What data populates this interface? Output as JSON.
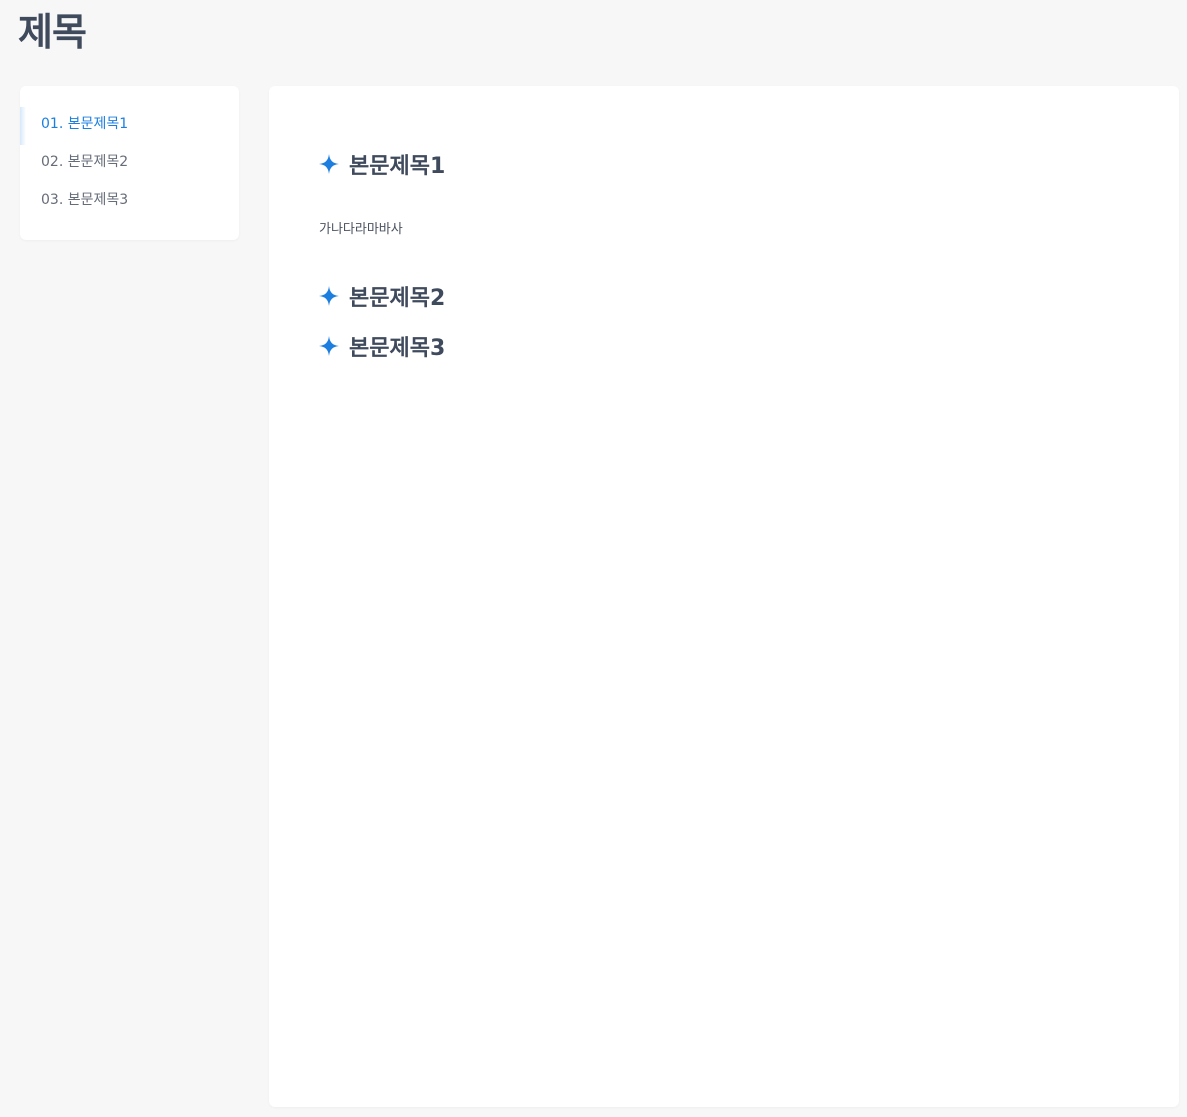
{
  "page": {
    "title": "제목"
  },
  "toc": {
    "items": [
      {
        "label": "01. 본문제목1",
        "active": true
      },
      {
        "label": "02. 본문제목2",
        "active": false
      },
      {
        "label": "03. 본문제목3",
        "active": false
      }
    ]
  },
  "content": {
    "sections": [
      {
        "heading": "본문제목1",
        "body": "가나다라마바사"
      },
      {
        "heading": "본문제목2"
      },
      {
        "heading": "본문제목3"
      }
    ]
  },
  "icons": {
    "heading_marker": "sparkle-star-icon"
  },
  "colors": {
    "accent": "#1c7fe0",
    "text": "#3f4a5c",
    "background": "#f7f7f7",
    "card": "#ffffff"
  }
}
